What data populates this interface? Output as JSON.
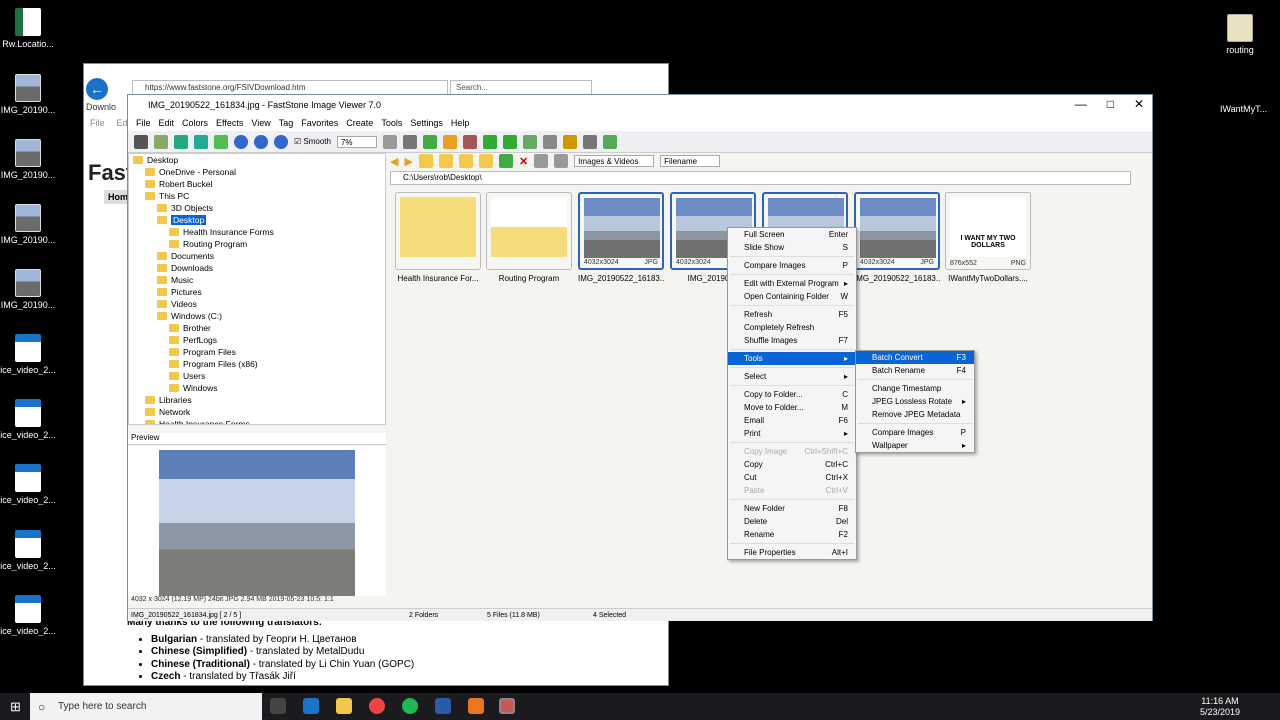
{
  "desktop": {
    "icons": [
      {
        "label": "Rw.Locatio...",
        "type": "xls"
      },
      {
        "label": "IMG_20190...",
        "type": "img"
      },
      {
        "label": "IMG_20190...",
        "type": "img"
      },
      {
        "label": "IMG_20190...",
        "type": "img"
      },
      {
        "label": "IMG_20190...",
        "type": "img"
      },
      {
        "label": "ice_video_2...",
        "type": "vid"
      },
      {
        "label": "ice_video_2...",
        "type": "vid"
      },
      {
        "label": "ice_video_2...",
        "type": "vid"
      },
      {
        "label": "ice_video_2...",
        "type": "vid"
      },
      {
        "label": "ice_video_2...",
        "type": "vid"
      }
    ],
    "routing_label": "routing",
    "iwant_label": "IWantMyT..."
  },
  "browser": {
    "url": "https://www.faststone.org/FSIVDownload.htm",
    "search_placeholder": "Search...",
    "tab": "Downlo",
    "menu": [
      "File",
      "Edit"
    ],
    "heading": "Fast",
    "home": "Home",
    "thanks": "Many thanks to the following translators:",
    "translators": [
      {
        "lang": "Bulgarian",
        "by": "- translated by Георги Н. Цветанов"
      },
      {
        "lang": "Chinese (Simplified)",
        "by": "- translated by MetalDudu"
      },
      {
        "lang": "Chinese (Traditional)",
        "by": "- translated by Li Chin Yuan (GOPC)"
      },
      {
        "lang": "Czech",
        "by": "- translated by Třasák Jiří"
      }
    ]
  },
  "fs": {
    "title": "IMG_20190522_161834.jpg - FastStone Image Viewer 7.0",
    "menu": [
      "File",
      "Edit",
      "Colors",
      "Effects",
      "View",
      "Tag",
      "Favorites",
      "Create",
      "Tools",
      "Settings",
      "Help"
    ],
    "smooth": "Smooth",
    "zoom": "7%",
    "filter": "Images & Videos",
    "sort": "Filename",
    "path": "C:\\Users\\rob\\Desktop\\",
    "tree": [
      {
        "label": "Desktop",
        "indent": 0
      },
      {
        "label": "OneDrive - Personal",
        "indent": 1
      },
      {
        "label": "Robert Buckel",
        "indent": 1
      },
      {
        "label": "This PC",
        "indent": 1
      },
      {
        "label": "3D Objects",
        "indent": 2
      },
      {
        "label": "Desktop",
        "indent": 2,
        "sel": true
      },
      {
        "label": "Health Insurance Forms",
        "indent": 3
      },
      {
        "label": "Routing Program",
        "indent": 3
      },
      {
        "label": "Documents",
        "indent": 2
      },
      {
        "label": "Downloads",
        "indent": 2
      },
      {
        "label": "Music",
        "indent": 2
      },
      {
        "label": "Pictures",
        "indent": 2
      },
      {
        "label": "Videos",
        "indent": 2
      },
      {
        "label": "Windows (C:)",
        "indent": 2
      },
      {
        "label": "Brother",
        "indent": 3
      },
      {
        "label": "PerfLogs",
        "indent": 3
      },
      {
        "label": "Program Files",
        "indent": 3
      },
      {
        "label": "Program Files (x86)",
        "indent": 3
      },
      {
        "label": "Users",
        "indent": 3
      },
      {
        "label": "Windows",
        "indent": 3
      },
      {
        "label": "Libraries",
        "indent": 1
      },
      {
        "label": "Network",
        "indent": 1
      },
      {
        "label": "Health Insurance Forms",
        "indent": 1
      }
    ],
    "preview_label": "Preview",
    "preview_info": "4032 x 3024 (12.19 MP)  24bit  JPG  2.94 MB  2019-05-23 10:5:  1:1",
    "status": {
      "file": "IMG_20190522_161834.jpg [ 2 / 5 ]",
      "folders": "2 Folders",
      "files": "5 Files (11.8 MB)",
      "selected": "4 Selected"
    },
    "thumbs": [
      {
        "cap": "Health Insurance For...",
        "kind": "folder",
        "dims": "",
        "ext": ""
      },
      {
        "cap": "Routing Program",
        "kind": "folder2",
        "dims": "",
        "ext": ""
      },
      {
        "cap": "IMG_20190522_16183...",
        "kind": "photo",
        "dims": "4032x3024",
        "ext": "JPG",
        "sel": true
      },
      {
        "cap": "IMG_2019052",
        "kind": "photo",
        "dims": "4032x3024",
        "ext": "",
        "sel": true
      },
      {
        "cap": "",
        "kind": "photo",
        "dims": "",
        "ext": "",
        "sel": true
      },
      {
        "cap": "IMG_20190522_16183...",
        "kind": "photo",
        "dims": "4032x3024",
        "ext": "JPG",
        "sel": true
      },
      {
        "cap": "IWantMyTwoDollars....",
        "kind": "meme",
        "dims": "876x552",
        "ext": "PNG",
        "meme": "I WANT MY TWO DOLLARS"
      }
    ]
  },
  "context_menu": [
    {
      "label": "Full Screen",
      "sc": "Enter"
    },
    {
      "label": "Slide Show",
      "sc": "S"
    },
    {
      "sep": true
    },
    {
      "label": "Compare Images",
      "sc": "P"
    },
    {
      "sep": true
    },
    {
      "label": "Edit with External Program",
      "sc": "▸"
    },
    {
      "label": "Open Containing Folder",
      "sc": "W"
    },
    {
      "sep": true
    },
    {
      "label": "Refresh",
      "sc": "F5"
    },
    {
      "label": "Completely Refresh",
      "sc": ""
    },
    {
      "label": "Shuffle Images",
      "sc": "F7"
    },
    {
      "sep": true
    },
    {
      "label": "Tools",
      "sc": "▸",
      "hl": true
    },
    {
      "sep": true
    },
    {
      "label": "Select",
      "sc": "▸"
    },
    {
      "sep": true
    },
    {
      "label": "Copy to Folder...",
      "sc": "C"
    },
    {
      "label": "Move to Folder...",
      "sc": "M"
    },
    {
      "label": "Email",
      "sc": "F6"
    },
    {
      "label": "Print",
      "sc": "▸"
    },
    {
      "sep": true
    },
    {
      "label": "Copy Image",
      "sc": "Ctrl+Shift+C",
      "dis": true
    },
    {
      "label": "Copy",
      "sc": "Ctrl+C"
    },
    {
      "label": "Cut",
      "sc": "Ctrl+X"
    },
    {
      "label": "Paste",
      "sc": "Ctrl+V",
      "dis": true
    },
    {
      "sep": true
    },
    {
      "label": "New Folder",
      "sc": "F8"
    },
    {
      "label": "Delete",
      "sc": "Del"
    },
    {
      "label": "Rename",
      "sc": "F2"
    },
    {
      "sep": true
    },
    {
      "label": "File Properties",
      "sc": "Alt+I"
    }
  ],
  "submenu": [
    {
      "label": "Batch Convert",
      "sc": "F3",
      "hl": true
    },
    {
      "label": "Batch Rename",
      "sc": "F4"
    },
    {
      "sep": true
    },
    {
      "label": "Change Timestamp",
      "sc": ""
    },
    {
      "label": "JPEG Lossless Rotate",
      "sc": "▸"
    },
    {
      "label": "Remove JPEG Metadata",
      "sc": ""
    },
    {
      "sep": true
    },
    {
      "label": "Compare Images",
      "sc": "P"
    },
    {
      "label": "Wallpaper",
      "sc": "▸"
    }
  ],
  "taskbar": {
    "search": "Type here to search",
    "time": "11:16 AM",
    "date": "5/23/2019"
  }
}
